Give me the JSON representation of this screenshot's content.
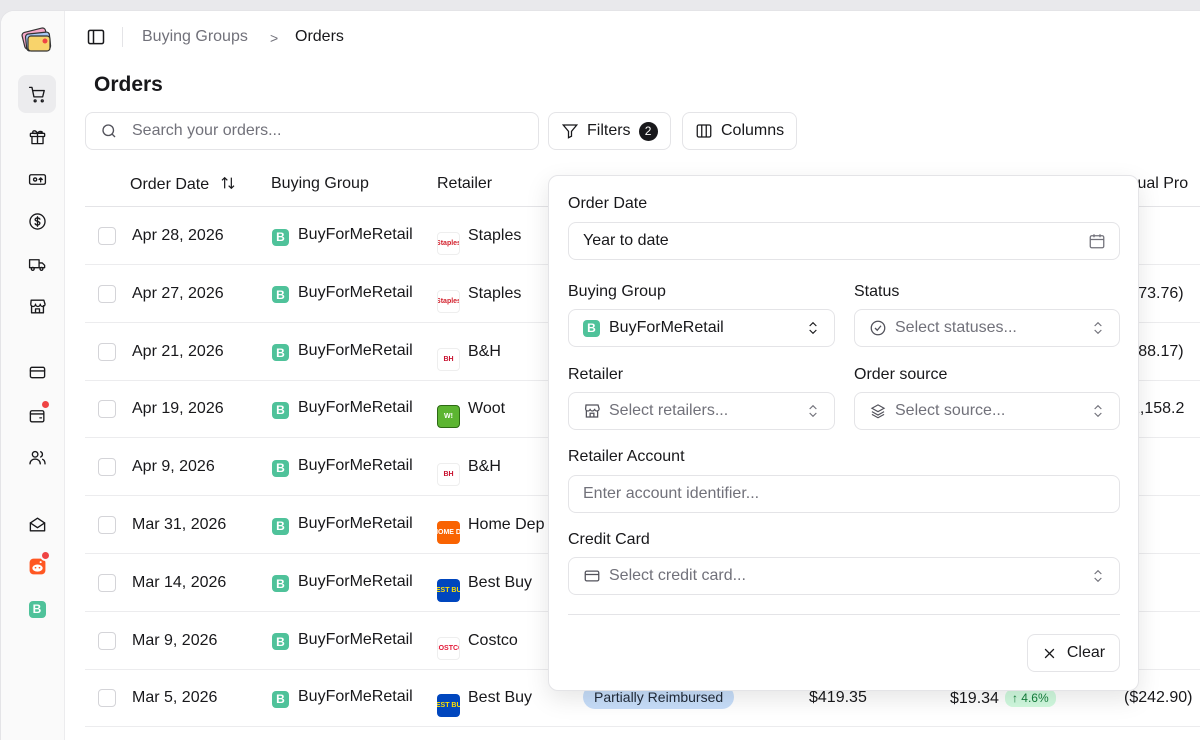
{
  "breadcrumb": {
    "parent": "Buying Groups",
    "separator": ">",
    "current": "Orders"
  },
  "page": {
    "title": "Orders"
  },
  "toolbar": {
    "search_placeholder": "Search your orders...",
    "filters_label": "Filters",
    "filters_count": "2",
    "columns_label": "Columns"
  },
  "table": {
    "headers": {
      "order_date": "Order Date",
      "buying_group": "Buying Group",
      "retailer": "Retailer",
      "actual_profit": "ctual Pro"
    },
    "sort_icon": "sort-arrows-icon",
    "rows": [
      {
        "date": "Apr 28, 2026",
        "group": "BuyForMeRetail",
        "retailer": "Staples",
        "logo": "staples",
        "actual": ""
      },
      {
        "date": "Apr 27, 2026",
        "group": "BuyForMeRetail",
        "retailer": "Staples",
        "logo": "staples",
        "actual": "(173.76)"
      },
      {
        "date": "Apr 21, 2026",
        "group": "BuyForMeRetail",
        "retailer": "B&H",
        "logo": "bh",
        "actual": "(388.17)"
      },
      {
        "date": "Apr 19, 2026",
        "group": "BuyForMeRetail",
        "retailer": "Woot",
        "logo": "woot",
        "actual": "1,158.2"
      },
      {
        "date": "Apr 9, 2026",
        "group": "BuyForMeRetail",
        "retailer": "B&H",
        "logo": "bh",
        "actual": ""
      },
      {
        "date": "Mar 31, 2026",
        "group": "BuyForMeRetail",
        "retailer": "Home Dep",
        "logo": "homedepot",
        "actual": ""
      },
      {
        "date": "Mar 14, 2026",
        "group": "BuyForMeRetail",
        "retailer": "Best Buy",
        "logo": "bestbuy",
        "actual": ""
      },
      {
        "date": "Mar 9, 2026",
        "group": "BuyForMeRetail",
        "retailer": "Costco",
        "logo": "costco",
        "actual": ""
      },
      {
        "date": "Mar 5, 2026",
        "group": "BuyForMeRetail",
        "retailer": "Best Buy",
        "logo": "bestbuy",
        "status": "Partially Reimbursed",
        "total": "$419.35",
        "profit": "$19.34",
        "profit_pct": "↑ 4.6%",
        "actual": "($242.90)"
      }
    ]
  },
  "logo_text": {
    "staples": "Staples",
    "bh": "BH",
    "woot": "W!",
    "homedepot": "THE HOME DEPOT",
    "bestbuy": "BEST BUY",
    "costco": "COSTCO"
  },
  "buying_group_icon_letter": "B",
  "filters_popover": {
    "order_date_label": "Order Date",
    "order_date_value": "Year to date",
    "buying_group_label": "Buying Group",
    "buying_group_value": "BuyForMeRetail",
    "status_label": "Status",
    "status_placeholder": "Select statuses...",
    "retailer_label": "Retailer",
    "retailer_placeholder": "Select retailers...",
    "order_source_label": "Order source",
    "order_source_placeholder": "Select source...",
    "retailer_account_label": "Retailer Account",
    "retailer_account_placeholder": "Enter account identifier...",
    "credit_card_label": "Credit Card",
    "credit_card_placeholder": "Select credit card...",
    "clear_label": "Clear"
  },
  "sidebar": {
    "items": [
      {
        "icon": "shopping-cart-icon",
        "active": true
      },
      {
        "icon": "gift-icon"
      },
      {
        "icon": "money-transfer-icon"
      },
      {
        "icon": "dollar-circle-icon"
      },
      {
        "icon": "truck-icon"
      },
      {
        "icon": "store-icon"
      },
      {
        "icon": "credit-card-icon"
      },
      {
        "icon": "wallet-icon",
        "notification": true
      },
      {
        "icon": "users-icon"
      },
      {
        "icon": "mail-open-icon"
      },
      {
        "icon": "reddit-icon",
        "notification": true
      },
      {
        "icon": "buying-group-b-icon"
      }
    ]
  },
  "colors": {
    "accent_green": "#4fc29a",
    "status_pill_bg": "#c7defa",
    "profit_badge_bg": "#d1fadf",
    "notification_red": "#ef4444"
  }
}
